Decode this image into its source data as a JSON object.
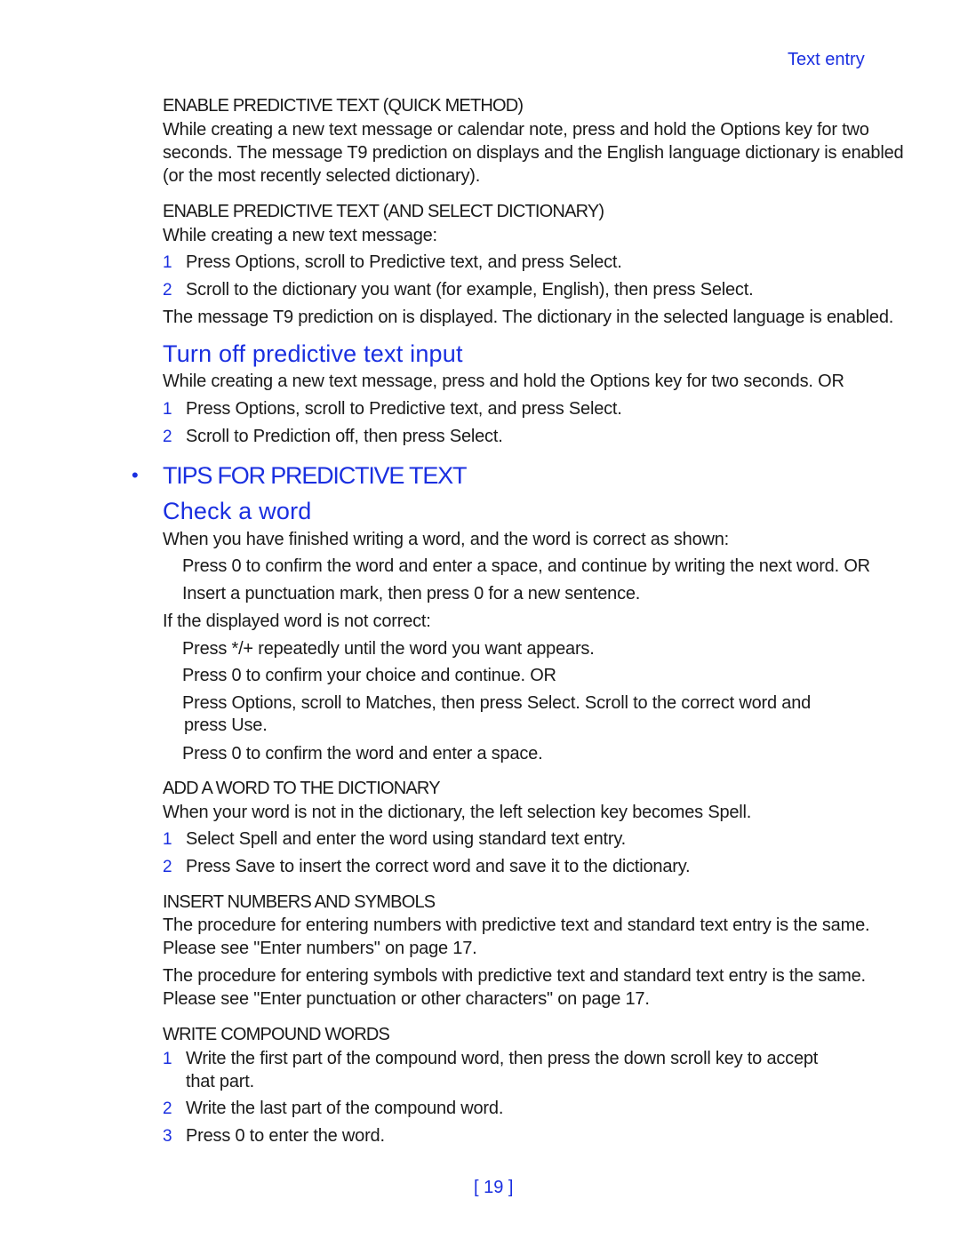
{
  "header": {
    "section": "Text entry"
  },
  "quick": {
    "heading": "ENABLE PREDICTIVE TEXT (QUICK METHOD)",
    "lines": [
      "While creating a new text message or calendar note, press and hold the Options key for two",
      "seconds. The message T9 prediction on displays and the English language dictionary is enabled",
      "(or the most recently selected dictionary)."
    ]
  },
  "select_dict": {
    "heading": "ENABLE PREDICTIVE TEXT (AND SELECT DICTIONARY)",
    "intro": "While creating a new text message:",
    "steps": [
      {
        "num": "1",
        "text": "Press Options, scroll to Predictive text, and press Select."
      },
      {
        "num": "2",
        "text": "Scroll to the dictionary you want (for example, English), then press Select."
      }
    ],
    "outro": "The message T9 prediction on is displayed. The dictionary in the selected language is enabled."
  },
  "turn_off": {
    "heading": "Turn off predictive text input",
    "intro": "While creating a new text message, press and hold the Options key for two seconds. OR",
    "steps": [
      {
        "num": "1",
        "text": "Press Options, scroll to Predictive text, and press Select."
      },
      {
        "num": "2",
        "text": "Scroll to Prediction off, then press Select."
      }
    ]
  },
  "tips": {
    "heading": "TIPS FOR PREDICTIVE TEXT",
    "check": {
      "heading": "Check a word",
      "intro_correct": "When you have finished writing a word, and the word is correct as shown:",
      "correct_items": [
        "Press 0 to confirm the word and enter a space, and continue by writing the next word. OR",
        "Insert a punctuation mark, then press 0 for a new sentence."
      ],
      "intro_incorrect": "If the displayed word is not correct:",
      "incorrect_items": [
        "Press */+ repeatedly until the word you want appears.",
        "Press 0 to confirm your choice and continue. OR",
        "Press Options, scroll to Matches, then press Select. Scroll to the correct word and",
        "press Use.",
        "Press 0 to confirm the word and enter a space."
      ]
    },
    "add_word": {
      "heading": "ADD A WORD TO THE DICTIONARY",
      "intro": "When your word is not in the dictionary, the left selection key becomes Spell.",
      "steps": [
        {
          "num": "1",
          "text": "Select Spell and enter the word using standard text entry."
        },
        {
          "num": "2",
          "text": "Press Save to insert the correct word and save it to the dictionary."
        }
      ]
    },
    "insert_numbers": {
      "heading": "INSERT NUMBERS AND SYMBOLS",
      "para1": [
        "The procedure for entering numbers with predictive text and standard text entry is the same.",
        "Please see \"Enter numbers\" on page 17."
      ],
      "para2": [
        "The procedure for entering symbols with predictive text and standard text entry is the same.",
        "Please see \"Enter punctuation or other characters\" on page 17."
      ]
    },
    "compound": {
      "heading": "WRITE COMPOUND WORDS",
      "steps": [
        {
          "num": "1",
          "text": "Write the first part of the compound word, then press the down scroll key to accept",
          "cont": "that part."
        },
        {
          "num": "2",
          "text": "Write the last part of the compound word."
        },
        {
          "num": "3",
          "text": "Press 0 to enter the word."
        }
      ]
    }
  },
  "footer": {
    "page": "[ 19 ]"
  }
}
